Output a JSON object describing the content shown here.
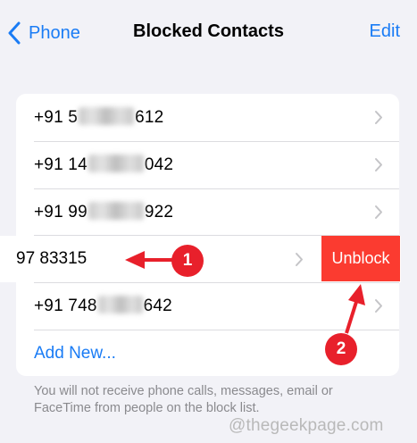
{
  "nav": {
    "back_label": "Phone",
    "title": "Blocked Contacts",
    "edit_label": "Edit"
  },
  "contacts": [
    {
      "prefix": "+91 5",
      "suffix": "612"
    },
    {
      "prefix": "+91 14",
      "suffix": "042"
    },
    {
      "prefix": "+91 99",
      "suffix": "922"
    },
    {
      "visible": "97 83315"
    },
    {
      "prefix": "+91 748",
      "suffix": "642"
    }
  ],
  "unblock_label": "Unblock",
  "add_new_label": "Add New...",
  "footer_text": "You will not receive phone calls, messages, email or FaceTime from people on the block list.",
  "watermark": "@thegeekpage.com",
  "annotations": {
    "badge1": "1",
    "badge2": "2"
  },
  "colors": {
    "accent": "#1a7cf5",
    "unblock": "#fb3b30",
    "annotation": "#e8202b"
  }
}
